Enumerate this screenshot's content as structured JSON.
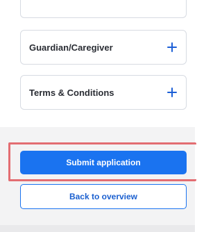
{
  "accordions": [
    {
      "label": "Guardian/Caregiver",
      "icon": "plus-icon"
    },
    {
      "label": "Terms & Conditions",
      "icon": "plus-icon"
    }
  ],
  "actions": {
    "submit_label": "Submit application",
    "back_label": "Back to overview"
  },
  "colors": {
    "primary": "#1a73f0",
    "highlight": "#e36d72",
    "footer_bg": "#f3f3f4"
  }
}
